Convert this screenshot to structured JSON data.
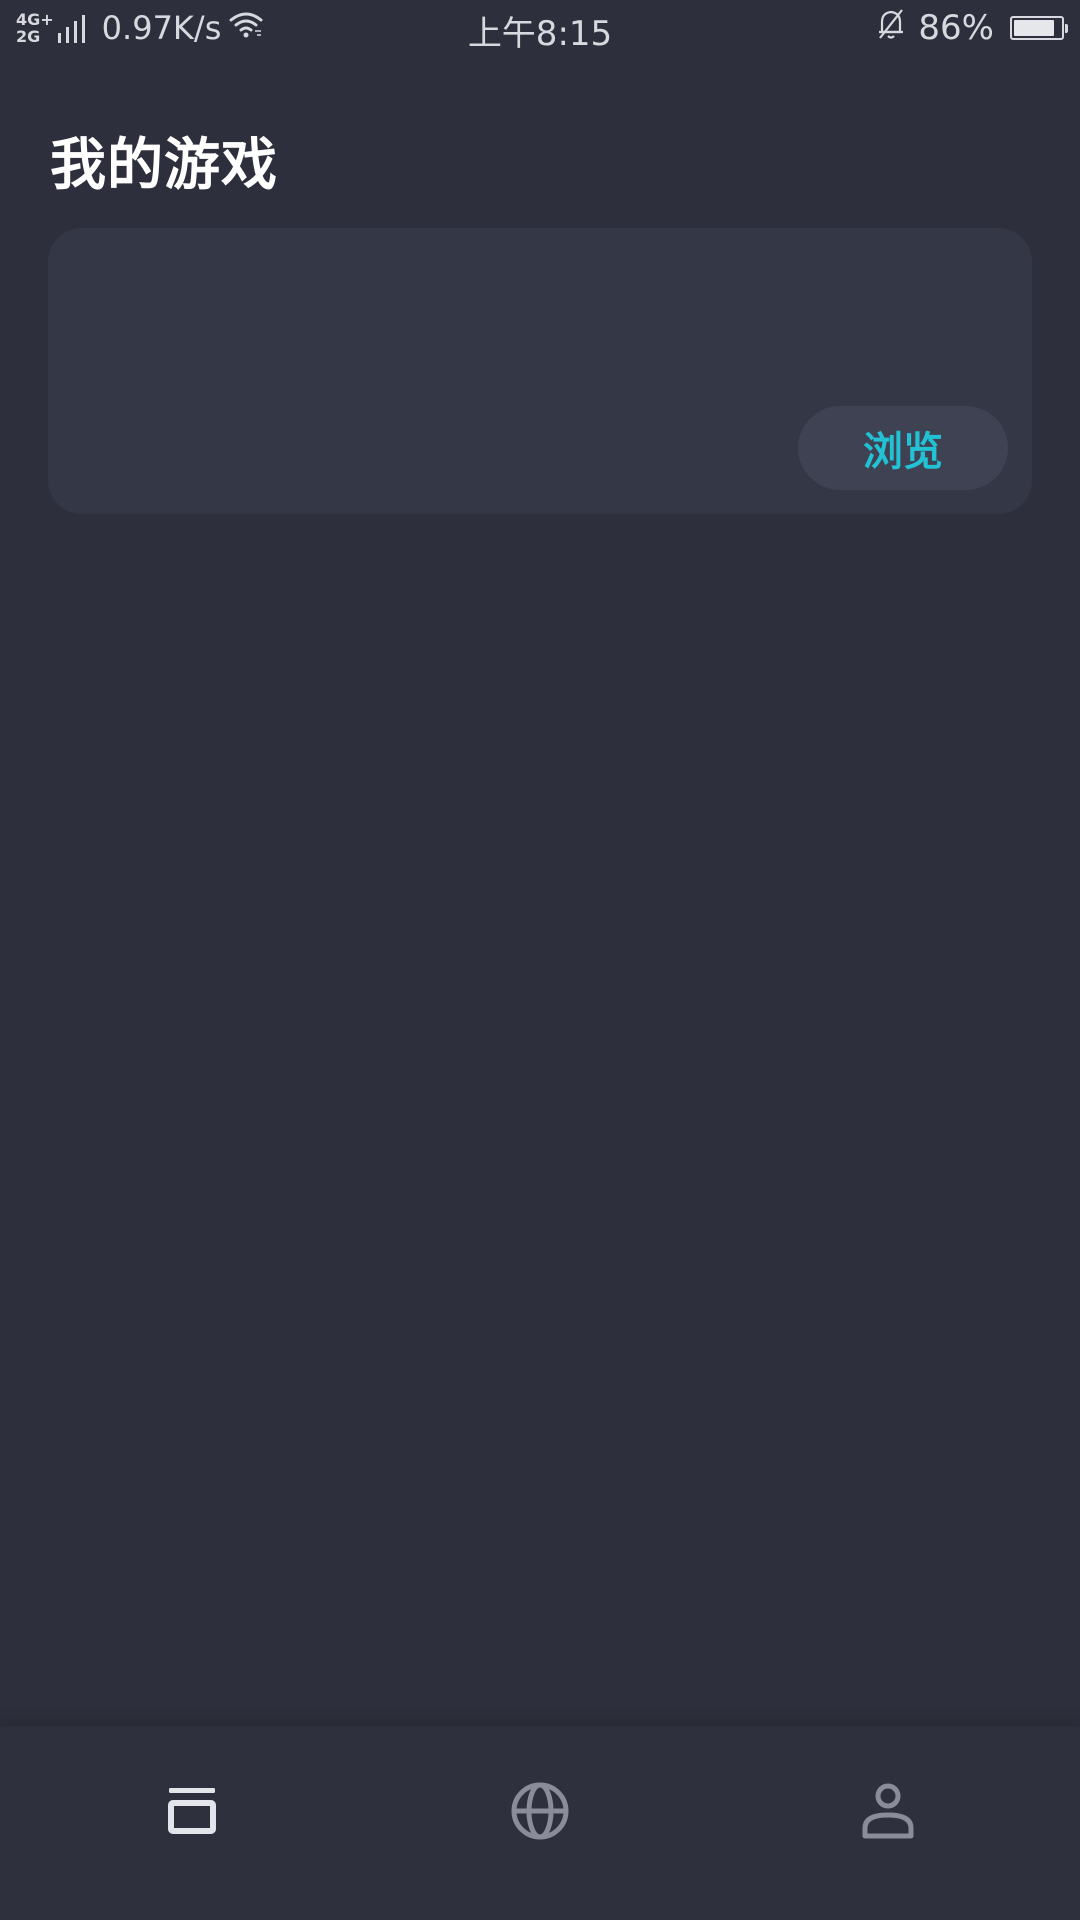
{
  "status_bar": {
    "network_type_top": "4G+",
    "network_type_bottom": "2G",
    "speed": "0.97K/s",
    "time": "上午8:15",
    "battery_percent": "86%",
    "battery_level": 0.86,
    "icons": [
      "signal-icon",
      "wifi-icon",
      "bell-off-icon",
      "battery-icon"
    ]
  },
  "header": {
    "title": "我的游戏"
  },
  "games_card": {
    "browse_label": "浏览"
  },
  "bottom_nav": {
    "items": [
      {
        "icon": "library-icon",
        "active": true
      },
      {
        "icon": "globe-icon",
        "active": false
      },
      {
        "icon": "profile-icon",
        "active": false
      }
    ]
  },
  "colors": {
    "background": "#2d303c",
    "card": "#343746",
    "accent": "#22c1d4",
    "nav_active": "#e4e5ea",
    "nav_inactive": "#8a8d99"
  }
}
